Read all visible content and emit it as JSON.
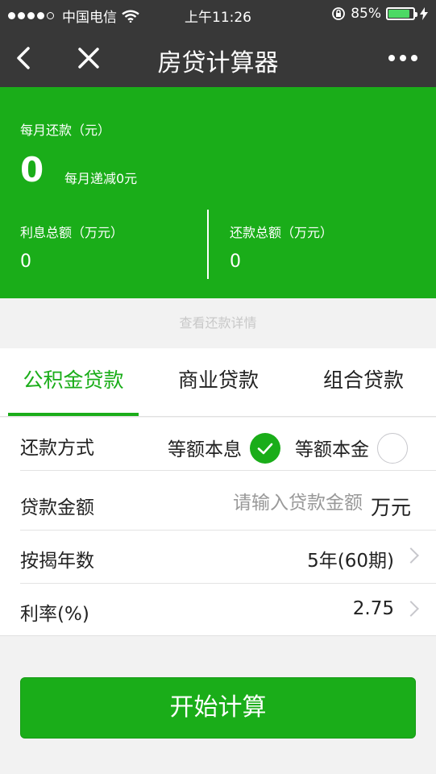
{
  "status_bar": {
    "carrier": "中国电信",
    "time": "上午11:26",
    "battery_percent": "85%"
  },
  "nav": {
    "title": "房贷计算器"
  },
  "summary": {
    "monthly_label": "每月还款（元）",
    "monthly_value": "0",
    "monthly_decrease": "每月递减0元",
    "interest_label": "利息总额（万元）",
    "interest_value": "0",
    "total_label": "还款总额（万元）",
    "total_value": "0"
  },
  "detail_link": "查看还款详情",
  "tabs": [
    {
      "label": "公积金贷款",
      "active": true
    },
    {
      "label": "商业贷款",
      "active": false
    },
    {
      "label": "组合贷款",
      "active": false
    }
  ],
  "form": {
    "repay_method": {
      "label": "还款方式",
      "options": [
        {
          "label": "等额本息",
          "selected": true
        },
        {
          "label": "等额本金",
          "selected": false
        }
      ]
    },
    "loan_amount": {
      "label": "贷款金额",
      "value": "",
      "placeholder": "请输入贷款金额",
      "unit": "万元"
    },
    "years": {
      "label": "按揭年数",
      "value": "5年(60期)"
    },
    "rate": {
      "label": "利率(%)",
      "value": "2.75"
    }
  },
  "start_button": "开始计算",
  "colors": {
    "accent": "#1aad19",
    "nav_bg": "#383838"
  }
}
